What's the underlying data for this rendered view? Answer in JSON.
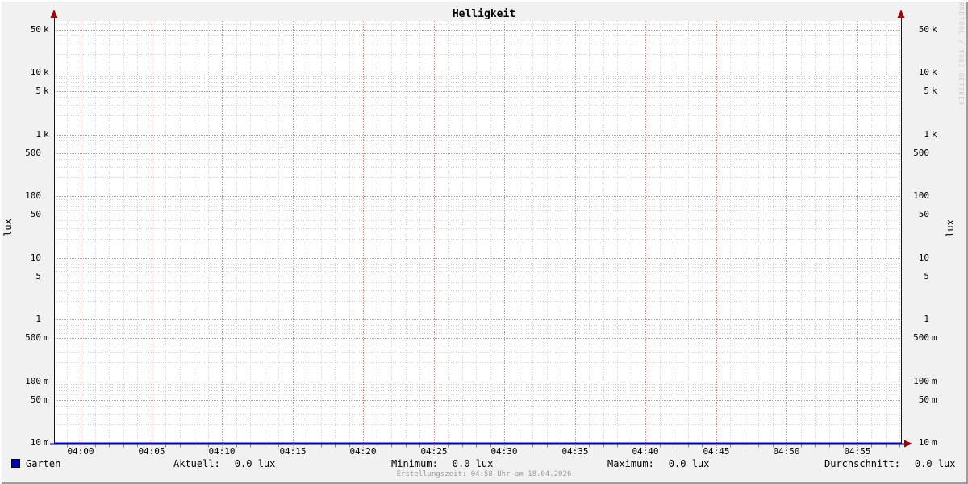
{
  "title": "Helligkeit",
  "watermark": "RRDTOOL / TOBI OETIKER",
  "footer": {
    "created_text": "Erstellungszeit: 04:58 Uhr am 18.04.2026"
  },
  "legend": {
    "series_label": "Garten",
    "stats": [
      {
        "label": "Aktuell:",
        "value": "0.0 lux"
      },
      {
        "label": "Minimum:",
        "value": "0.0 lux"
      },
      {
        "label": "Maximum:",
        "value": "0.0 lux"
      },
      {
        "label": "Durchschnitt:",
        "value": "0.0 lux"
      }
    ]
  },
  "chart_data": {
    "type": "line",
    "title": "Helligkeit",
    "ylabel": "lux",
    "ylabel_right": "lux",
    "y_scale": "log10",
    "y_range": [
      0.01,
      68000
    ],
    "y_unit": "lux",
    "y_ticks": [
      {
        "value": 50000,
        "label": "50 k"
      },
      {
        "value": 10000,
        "label": "10 k"
      },
      {
        "value": 5000,
        "label": "5 k"
      },
      {
        "value": 1000,
        "label": "1 k"
      },
      {
        "value": 500,
        "label": "500"
      },
      {
        "value": 100,
        "label": "100"
      },
      {
        "value": 50,
        "label": "50"
      },
      {
        "value": 10,
        "label": "10"
      },
      {
        "value": 5,
        "label": "5"
      },
      {
        "value": 1,
        "label": "1"
      },
      {
        "value": 0.5,
        "label": "500 m"
      },
      {
        "value": 0.1,
        "label": "100 m"
      },
      {
        "value": 0.05,
        "label": "50 m"
      },
      {
        "value": 0.01,
        "label": "10 m"
      }
    ],
    "x_range": [
      "03:58",
      "04:58"
    ],
    "x_ticks": [
      "04:00",
      "04:05",
      "04:10",
      "04:15",
      "04:20",
      "04:25",
      "04:30",
      "04:35",
      "04:40",
      "04:45",
      "04:50",
      "04:55"
    ],
    "x_minor_step_minutes": 1,
    "x_major_step_minutes": 5,
    "grid": {
      "major_color": "#e08a8a",
      "minor_color": "#cfcfcf",
      "grid_on": true
    },
    "axis_colors": {
      "axis": "#00006a",
      "vertical_axis": "#151515",
      "arrow": "#a40000"
    },
    "background": {
      "canvas": "#f1f1f1",
      "plot": "#ffffff"
    },
    "legend_position": "bottom",
    "series": [
      {
        "name": "Garten",
        "color": "#0000cc",
        "style": "line",
        "constant_value": 0.0,
        "unit": "lux"
      }
    ],
    "stats": {
      "aktuell": 0.0,
      "minimum": 0.0,
      "maximum": 0.0,
      "durchschnitt": 0.0
    }
  }
}
